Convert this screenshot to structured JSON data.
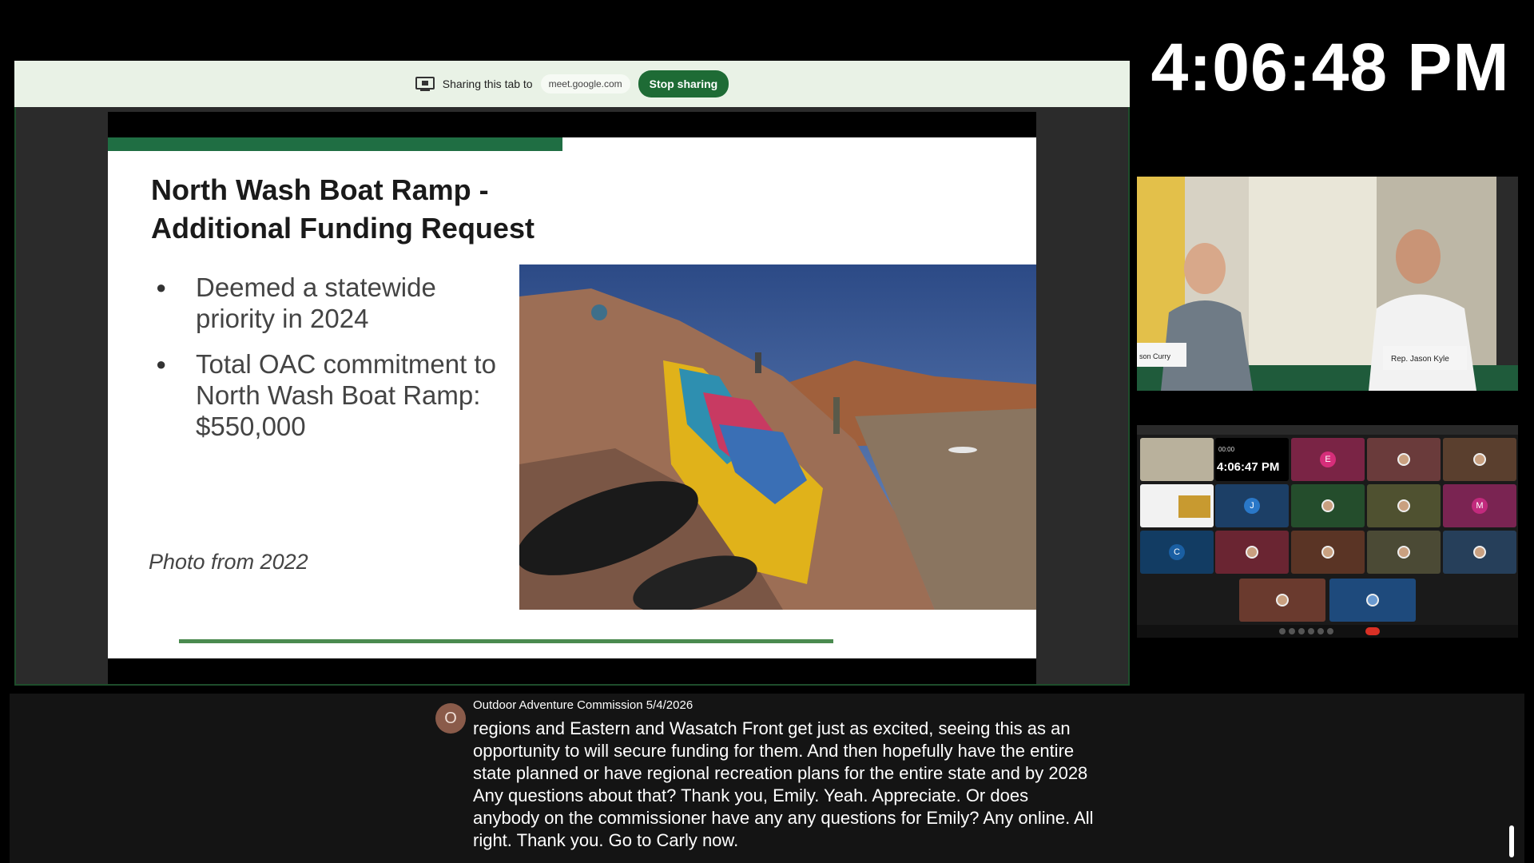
{
  "clock": {
    "time": "4:06:48 PM"
  },
  "share_bar": {
    "sharing_text": "Sharing this tab to",
    "host": "meet.google.com",
    "stop_button": "Stop sharing"
  },
  "slide": {
    "title": "North Wash Boat Ramp - Additional Funding Request",
    "bullets": [
      "Deemed a statewide priority in 2024",
      "Total OAC commitment to North Wash Boat Ramp: $550,000"
    ],
    "caption": "Photo from 2022"
  },
  "camera": {
    "nameplate_left": "son Curry",
    "nameplate_right": "Rep. Jason Kyle"
  },
  "meet_grid": {
    "clock": "4:06:47 PM",
    "timer": "00:00",
    "initials": [
      "E",
      "J",
      "M",
      "C"
    ]
  },
  "captions": {
    "avatar_initial": "O",
    "speaker": "Outdoor Adventure Commission 5/4/2026",
    "text": "regions and Eastern and Wasatch Front get just as excited, seeing this as an opportunity to will secure funding for them. And then hopefully have the entire state planned or have regional recreation plans for the entire state and by 2028 Any questions about that? Thank you, Emily. Yeah. Appreciate. Or does anybody on the commissioner have any any questions for Emily? Any online. All right. Thank you. Go to Carly now."
  },
  "colors": {
    "share_bar_bg": "#e9f2e6",
    "stop_button": "#1e6b35",
    "slide_accent": "#1f6e43",
    "caption_bg": "#141414"
  }
}
